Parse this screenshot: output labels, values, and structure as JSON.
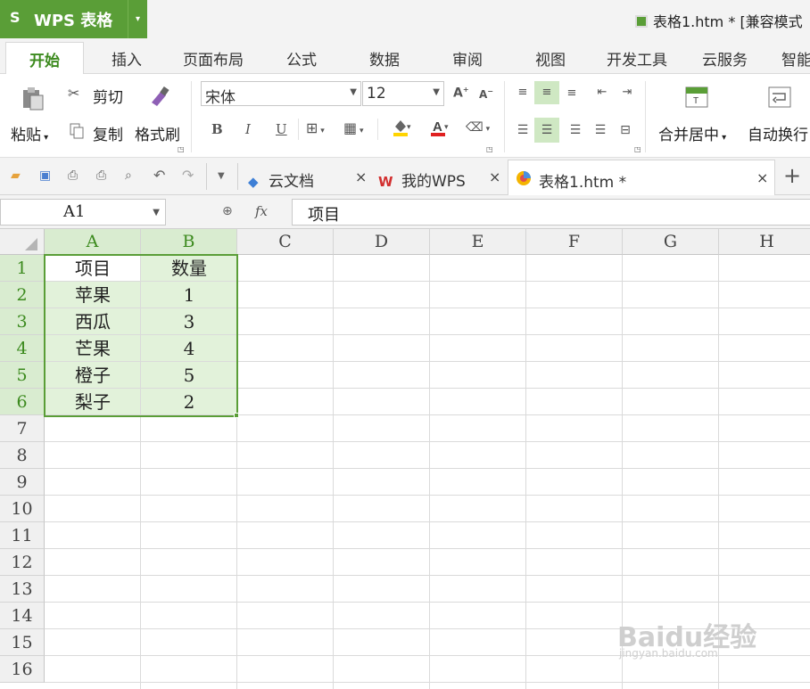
{
  "titlebar": {
    "app_name": "WPS 表格",
    "logo_glyph": "S",
    "dropdown_glyph": "▾",
    "doc_title": "表格1.htm * [兼容模式"
  },
  "menu_tabs": [
    "开始",
    "插入",
    "页面布局",
    "公式",
    "数据",
    "审阅",
    "视图",
    "开发工具",
    "云服务",
    "智能"
  ],
  "ribbon": {
    "paste_label": "粘贴",
    "cut_label": "剪切",
    "copy_label": "复制",
    "format_painter_label": "格式刷",
    "font_name": "宋体",
    "font_size": "12",
    "bold": "B",
    "italic": "I",
    "underline": "U",
    "merge_center_label": "合并居中",
    "wrap_text_label": "自动换行"
  },
  "doc_tabs": [
    {
      "label": "云文档",
      "close": "×"
    },
    {
      "label": "我的WPS",
      "close": "×"
    },
    {
      "label": "表格1.htm *",
      "close": "×"
    }
  ],
  "add_tab_glyph": "+",
  "formula_bar": {
    "cell_ref": "A1",
    "fx": "fx",
    "content": "项目"
  },
  "columns": [
    "A",
    "B",
    "C",
    "D",
    "E",
    "F",
    "G",
    "H"
  ],
  "rows": [
    "1",
    "2",
    "3",
    "4",
    "5",
    "6",
    "7",
    "8",
    "9",
    "10",
    "11",
    "12",
    "13",
    "14",
    "15",
    "16"
  ],
  "sheet": {
    "header": [
      "项目",
      "数量"
    ],
    "data": [
      [
        "苹果",
        "1"
      ],
      [
        "西瓜",
        "3"
      ],
      [
        "芒果",
        "4"
      ],
      [
        "橙子",
        "5"
      ],
      [
        "梨子",
        "2"
      ]
    ]
  },
  "watermark": {
    "text": "Baidu经验",
    "url": "jingyan.baidu.com"
  },
  "colors": {
    "accent": "#5a9e37",
    "selection_fill": "#e2f2da",
    "header_selected": "#d9ecd0"
  }
}
